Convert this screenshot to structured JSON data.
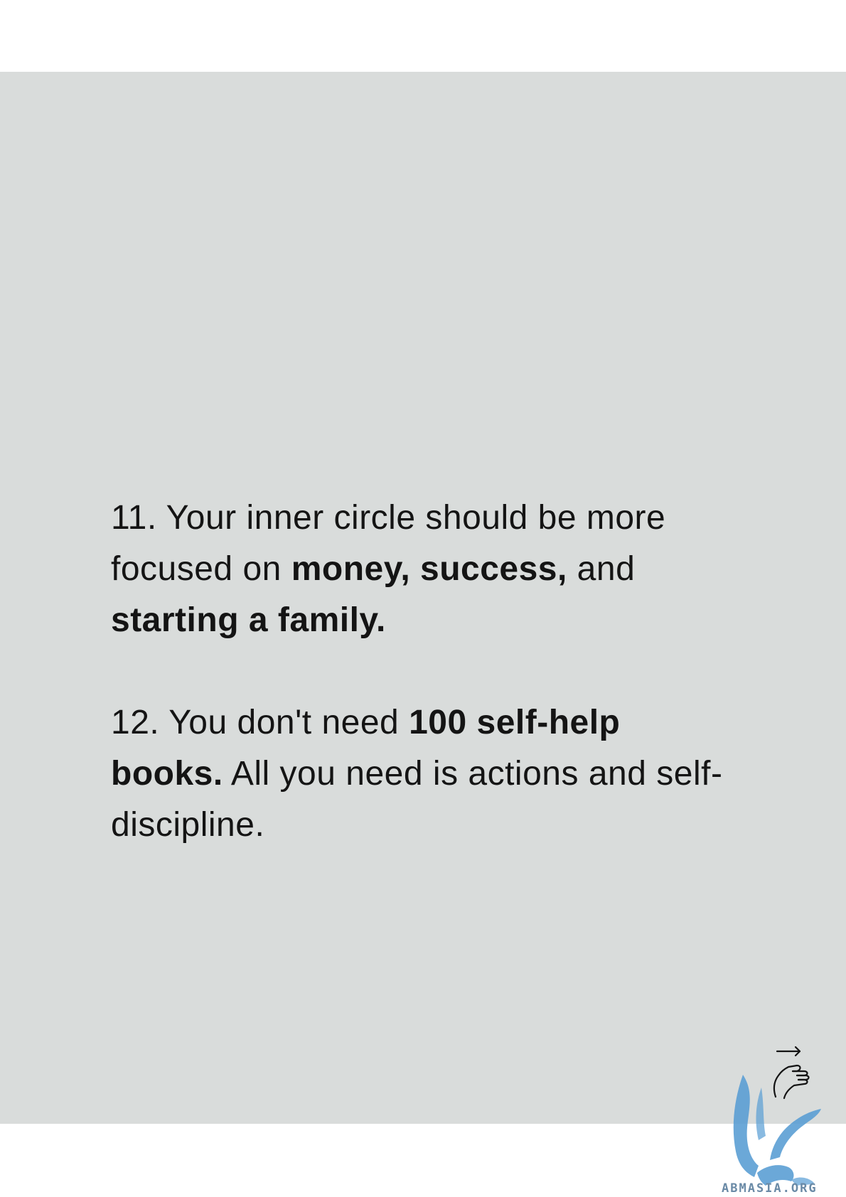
{
  "post": {
    "item_11": {
      "lead": "11. Your inner circle should be more focused on ",
      "bold_1": "money, success,",
      "mid": " and ",
      "bold_2": "starting a family."
    },
    "item_12": {
      "lead": "12. You don't need ",
      "bold_1": "100 self-help books.",
      "tail": " All you need is actions and self-discipline."
    }
  },
  "icons": {
    "swipe": "swipe-hand-icon",
    "watermark_logo": "eagle-logo-icon"
  },
  "watermark": {
    "text": "ABMASIA.ORG",
    "color": "#6a8aa6"
  },
  "colors": {
    "card_background": "#d9dcdb",
    "text": "#141414"
  }
}
